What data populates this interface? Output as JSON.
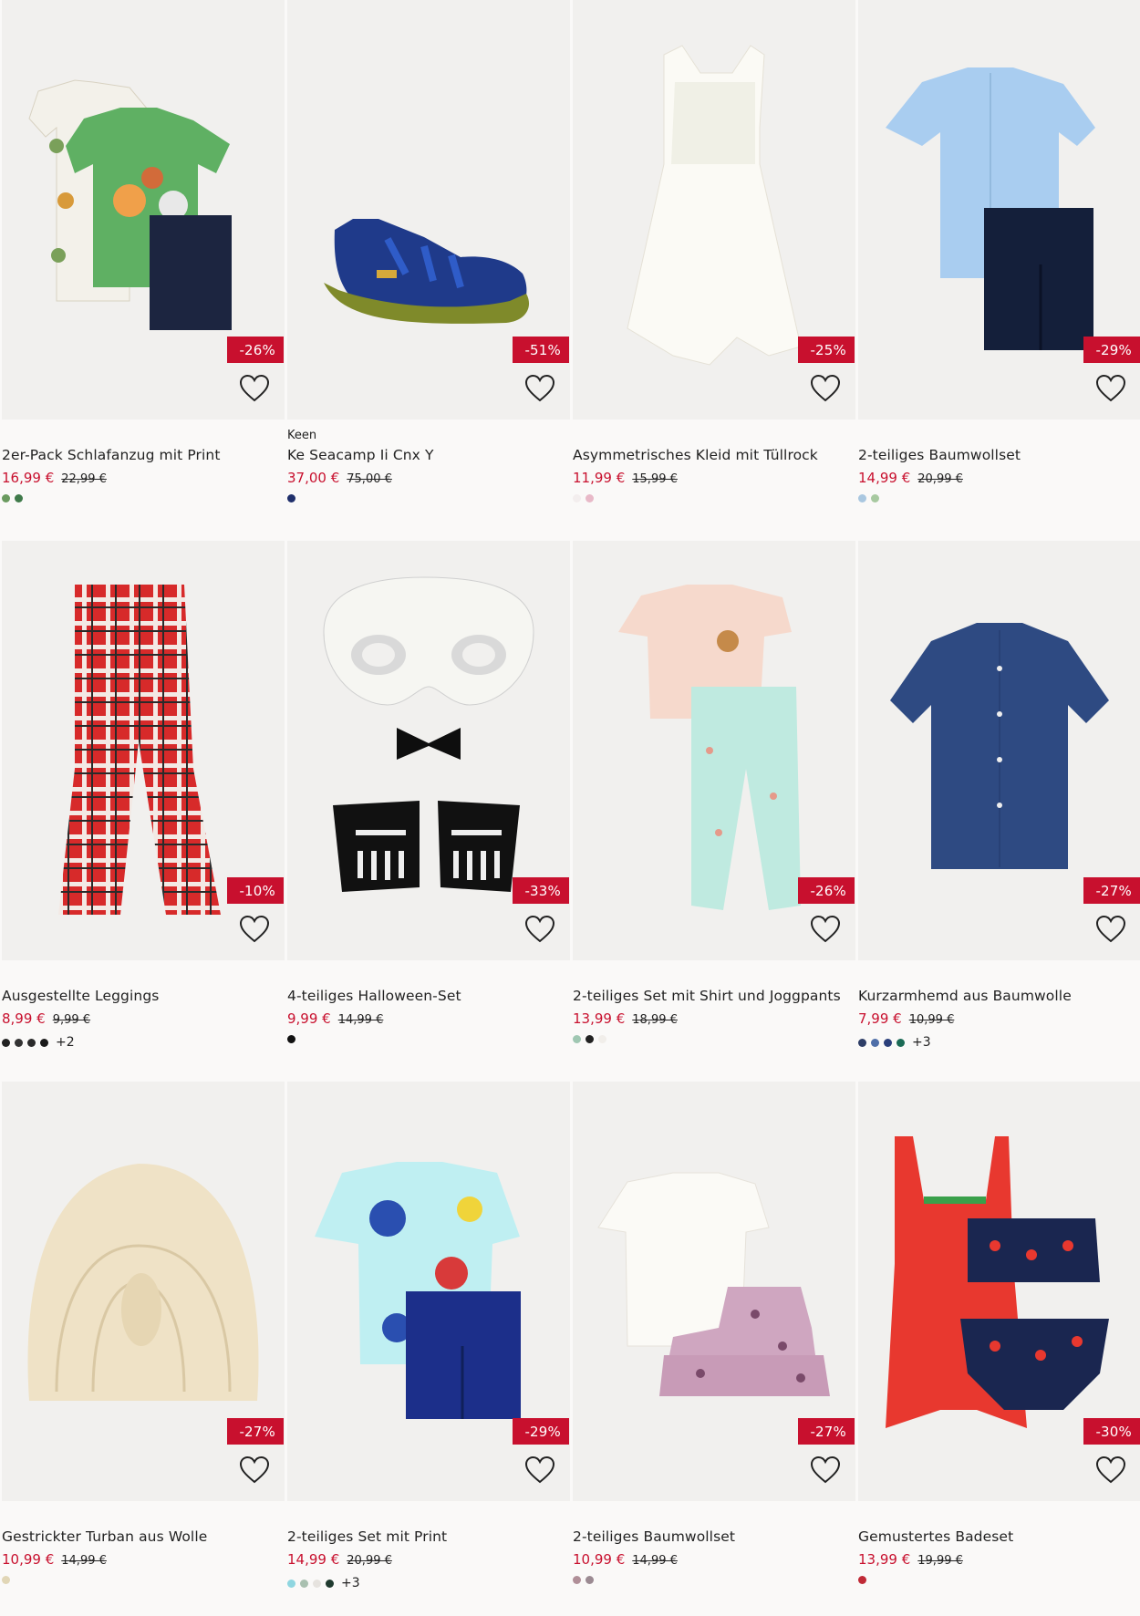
{
  "products": [
    {
      "brand": "",
      "name": "2er-Pack Schlafanzug mit Print",
      "price": "16,99 €",
      "old_price": "22,99 €",
      "discount": "-26%",
      "swatches": [
        "#6a9a5f",
        "#3f7a4a"
      ],
      "more": "",
      "icon": "pajama-set-image"
    },
    {
      "brand": "Keen",
      "name": "Ke Seacamp Ii Cnx Y",
      "price": "37,00 €",
      "old_price": "75,00 €",
      "discount": "-51%",
      "swatches": [
        "#1f2f6b"
      ],
      "more": "",
      "icon": "sandal-image"
    },
    {
      "brand": "",
      "name": "Asymmetrisches Kleid mit Tüllrock",
      "price": "11,99 €",
      "old_price": "15,99 €",
      "discount": "-25%",
      "swatches": [
        "#f3eeee",
        "#e8b9c8"
      ],
      "more": "",
      "icon": "dress-image"
    },
    {
      "brand": "",
      "name": "2-teiliges Baumwollset",
      "price": "14,99 €",
      "old_price": "20,99 €",
      "discount": "-29%",
      "swatches": [
        "#a9c7e0",
        "#a7c9a0"
      ],
      "more": "",
      "icon": "shirt-shorts-image"
    },
    {
      "brand": "",
      "name": "Ausgestellte Leggings",
      "price": "8,99 €",
      "old_price": "9,99 €",
      "discount": "-10%",
      "swatches": [
        "#222",
        "#333",
        "#2a2a2a",
        "#1a1a1a"
      ],
      "more": "+2",
      "icon": "leggings-image"
    },
    {
      "brand": "",
      "name": "4-teiliges Halloween-Set",
      "price": "9,99 €",
      "old_price": "14,99 €",
      "discount": "-33%",
      "swatches": [
        "#111"
      ],
      "more": "",
      "icon": "halloween-set-image"
    },
    {
      "brand": "",
      "name": "2-teiliges Set mit Shirt und Joggpants",
      "price": "13,99 €",
      "old_price": "18,99 €",
      "discount": "-26%",
      "swatches": [
        "#9fc7b2",
        "#222",
        "#f1eeea"
      ],
      "more": "",
      "icon": "shirt-joggers-image"
    },
    {
      "brand": "",
      "name": "Kurzarmhemd aus Baumwolle",
      "price": "7,99 €",
      "old_price": "10,99 €",
      "discount": "-27%",
      "swatches": [
        "#2d3d66",
        "#4e6ea8",
        "#2a3f7a",
        "#1a6a55"
      ],
      "more": "+3",
      "icon": "button-shirt-image"
    },
    {
      "brand": "",
      "name": "Gestrickter Turban aus Wolle",
      "price": "10,99 €",
      "old_price": "14,99 €",
      "discount": "-27%",
      "swatches": [
        "#e1d6b6"
      ],
      "more": "",
      "icon": "turban-image"
    },
    {
      "brand": "",
      "name": "2-teiliges Set mit Print",
      "price": "14,99 €",
      "old_price": "20,99 €",
      "discount": "-29%",
      "swatches": [
        "#8fd6e0",
        "#a9c0b0",
        "#e6e3df",
        "#1f3a2f"
      ],
      "more": "+3",
      "icon": "print-set-image"
    },
    {
      "brand": "",
      "name": "2-teiliges Baumwollset",
      "price": "10,99 €",
      "old_price": "14,99 €",
      "discount": "-27%",
      "swatches": [
        "#b08f98",
        "#9b8a92"
      ],
      "more": "",
      "icon": "top-skirt-image"
    },
    {
      "brand": "",
      "name": "Gemustertes Badeset",
      "price": "13,99 €",
      "old_price": "19,99 €",
      "discount": "-30%",
      "swatches": [
        "#c02a36"
      ],
      "more": "",
      "icon": "swimsuit-set-image"
    }
  ]
}
